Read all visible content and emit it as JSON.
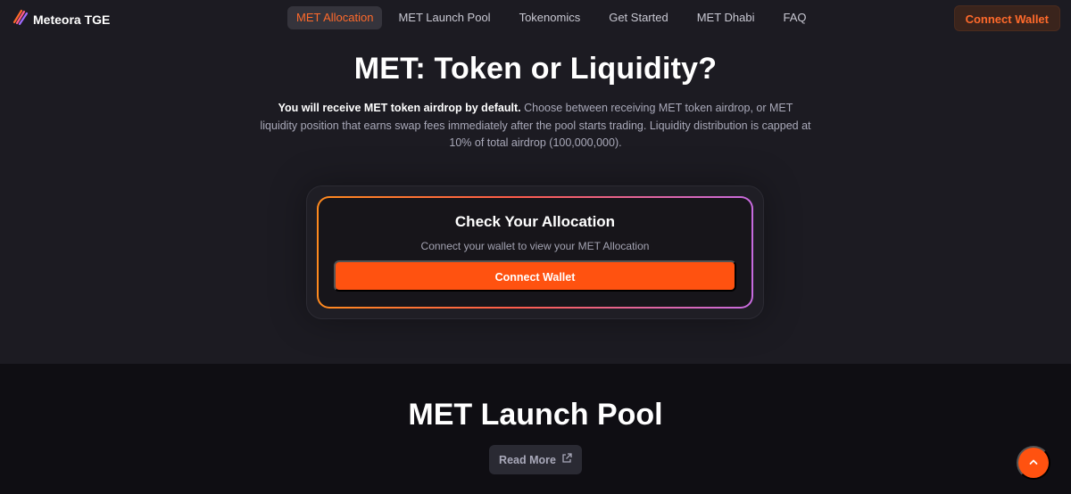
{
  "nav": {
    "brand": "Meteora TGE",
    "links": [
      "MET Allocation",
      "MET Launch Pool",
      "Tokenomics",
      "Get Started",
      "MET Dhabi",
      "FAQ"
    ],
    "active_index": 0,
    "connect_label": "Connect Wallet"
  },
  "hero": {
    "title": "MET: Token or Liquidity?",
    "desc_strong": "You will receive MET token airdrop by default.",
    "desc_rest": "Choose between receiving MET token airdrop, or MET liquidity position that earns swap fees immediately after the pool starts trading. Liquidity distribution is capped at 10% of total airdrop (100,000,000)."
  },
  "allocation_card": {
    "title": "Check Your Allocation",
    "subtitle": "Connect your wallet to view your MET Allocation",
    "button_label": "Connect Wallet"
  },
  "launch_pool": {
    "title": "MET Launch Pool",
    "read_more_label": "Read More"
  },
  "icons": {
    "logo": "meteora-logo-icon",
    "external": "external-link-icon",
    "scroll_top": "chevron-up-icon"
  },
  "colors": {
    "accent": "#ff5210",
    "nav_active_text": "#ff6a2b",
    "background": "#1c1b22",
    "section_background": "#0f0e13"
  }
}
